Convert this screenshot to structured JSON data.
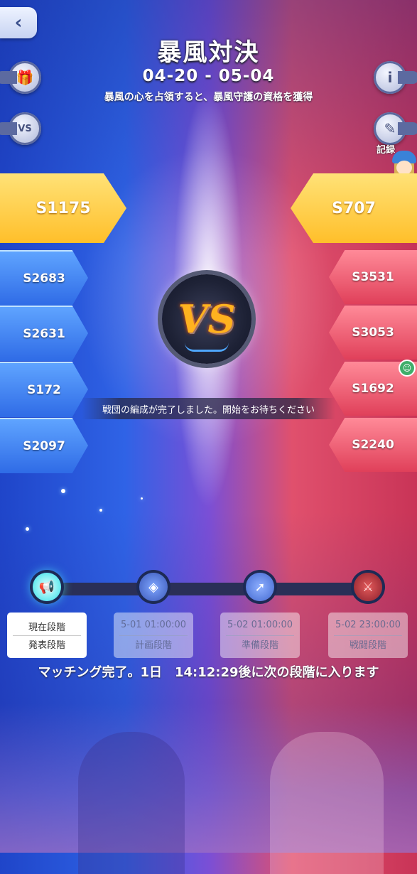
{
  "header": {
    "back_icon": "chevron-left-icon",
    "title": "暴風対決",
    "dates": "04-20 - 05-04",
    "subtitle": "暴風の心を占領すると、暴風守護の資格を獲得"
  },
  "side_buttons": {
    "gift_icon": "gift-icon",
    "vs_icon": "vs-card-icon",
    "info_icon": "info-icon",
    "record_icon": "clipboard-icon",
    "record_label": "記録"
  },
  "left_team": {
    "leader": "S1175",
    "servers": [
      "S2683",
      "S2631",
      "S172",
      "S2097"
    ]
  },
  "right_team": {
    "leader": "S707",
    "servers": [
      "S3531",
      "S3053",
      "S1692",
      "S2240"
    ]
  },
  "vs_label": "VS",
  "status_banner": "戦団の編成が完了しました。開始をお待ちください",
  "timeline": {
    "phases": [
      {
        "line1": "現在段階",
        "line2": "発表段階",
        "state": "current",
        "icon": "megaphone-icon"
      },
      {
        "line1": "5-01 01:00:00",
        "line2": "計画段階",
        "state": "future",
        "icon": "grid-icon"
      },
      {
        "line1": "5-02 01:00:00",
        "line2": "準備段階",
        "state": "future",
        "icon": "rocket-icon"
      },
      {
        "line1": "5-02 23:00:00",
        "line2": "戦闘段階",
        "state": "future",
        "icon": "crossed-swords-icon"
      }
    ]
  },
  "notice": "マッチング完了。1日　14:12:29後に次の段階に入ります",
  "colors": {
    "blue_team": "#2f6be6",
    "red_team": "#e0405a",
    "gold": "#ffbf2a",
    "active_phase": "#2de0e8"
  }
}
